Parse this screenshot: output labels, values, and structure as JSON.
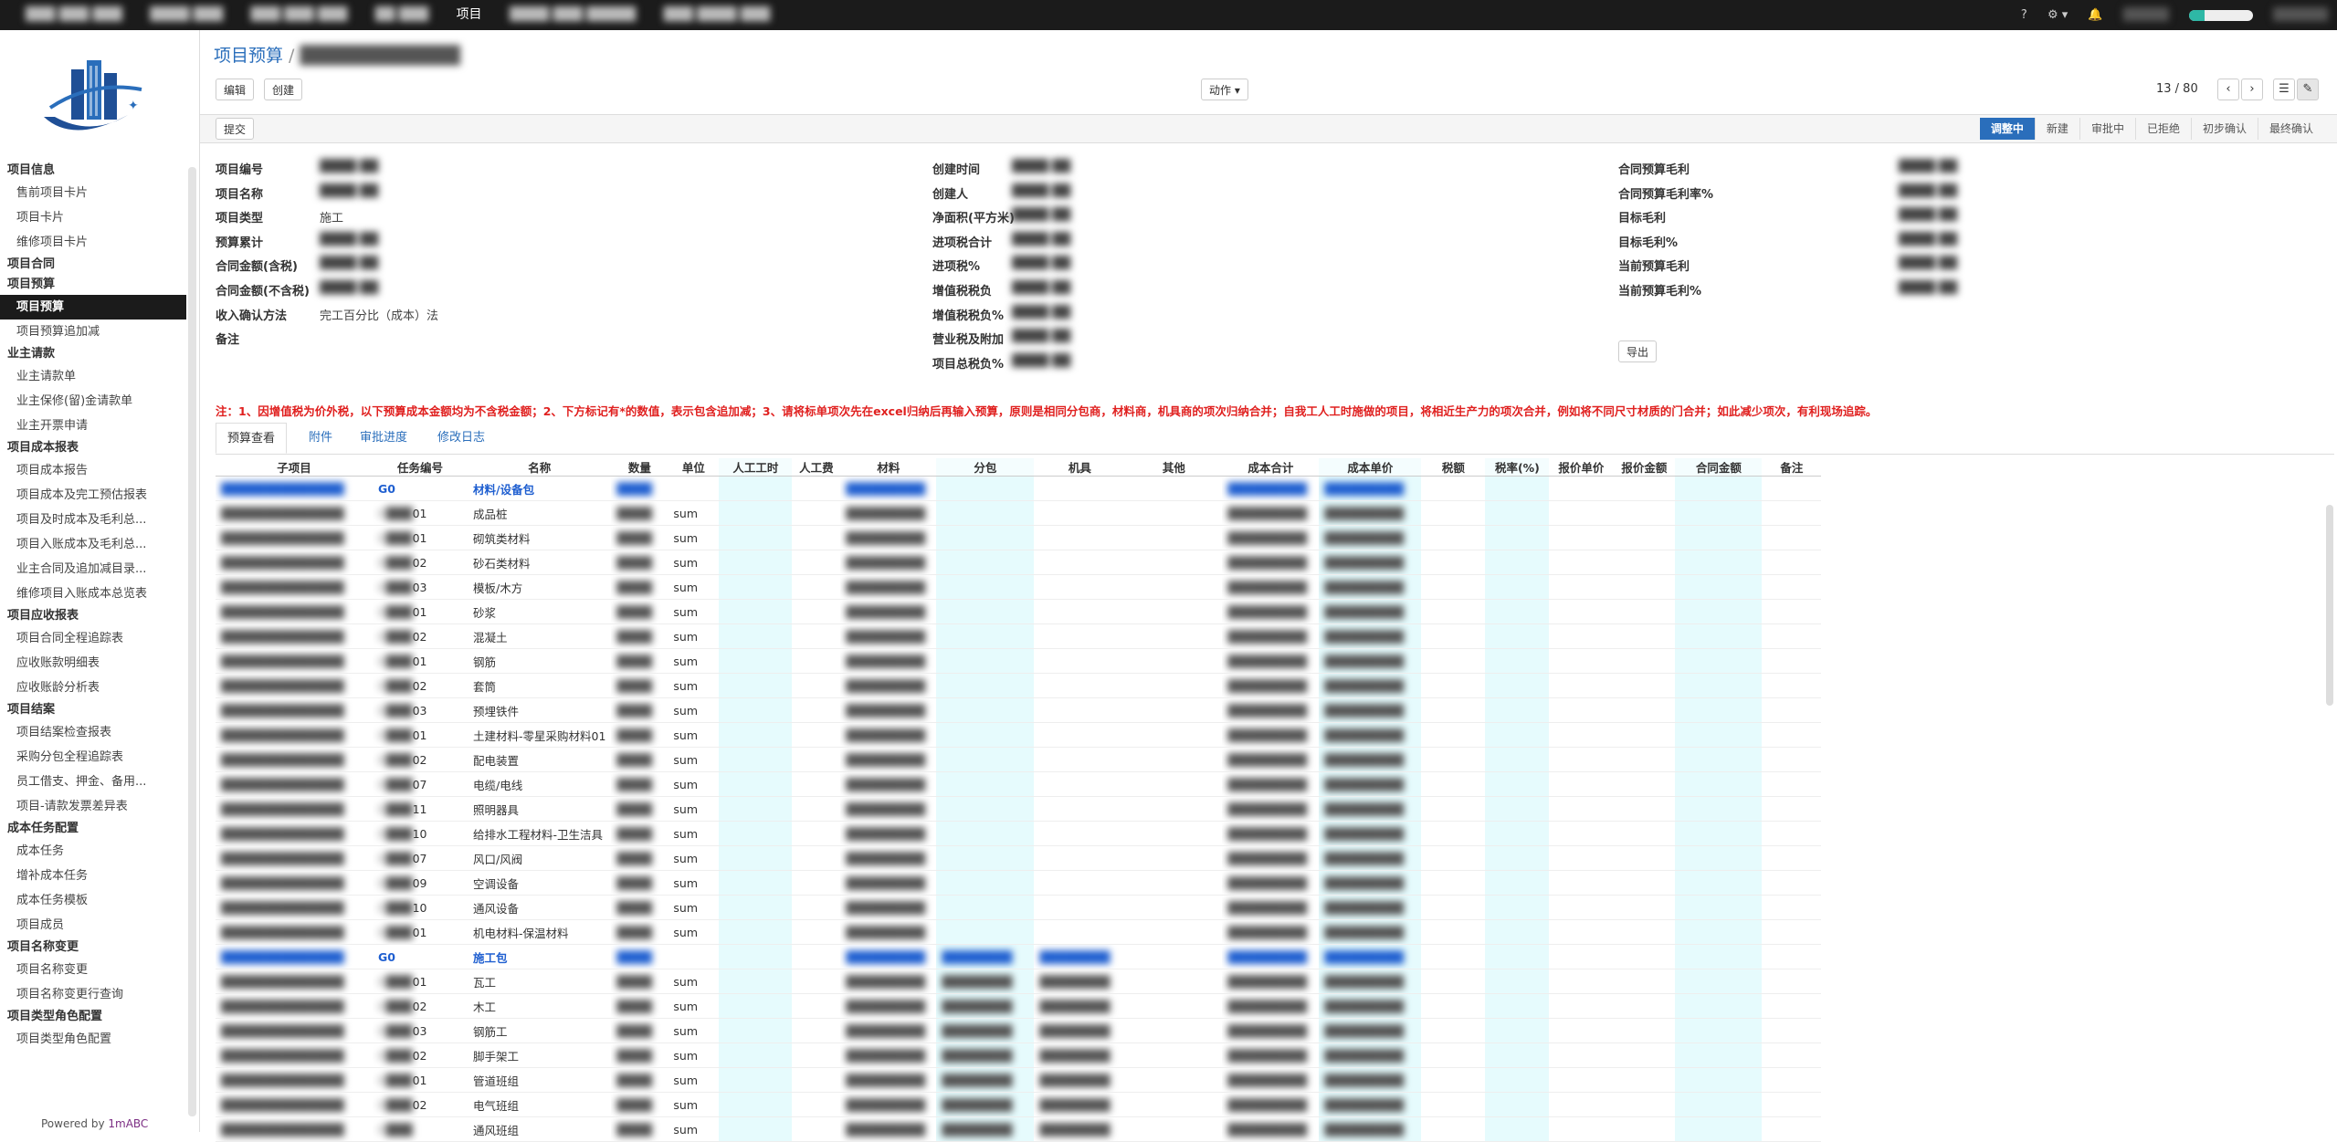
{
  "topbar": {
    "menu": [
      "项目"
    ],
    "right": [
      "?",
      "⚙ ▾",
      "🔔"
    ],
    "progress": 0.25
  },
  "sidebar": {
    "powered_prefix": "Powered by ",
    "powered_brand": "1mABC",
    "groups": [
      {
        "title": "项目信息",
        "items": [
          "售前项目卡片",
          "项目卡片",
          "维修项目卡片"
        ]
      },
      {
        "title": "项目合同",
        "items": []
      },
      {
        "title": "项目预算",
        "items": [
          "项目预算",
          "项目预算追加减"
        ]
      },
      {
        "title": "业主请款",
        "items": [
          "业主请款单",
          "业主保修(留)金请款单",
          "业主开票申请"
        ]
      },
      {
        "title": "项目成本报表",
        "items": [
          "项目成本报告",
          "项目成本及完工预估报表",
          "项目及时成本及毛利总...",
          "项目入账成本及毛利总...",
          "业主合同及追加减目录...",
          "维修项目入账成本总览表"
        ]
      },
      {
        "title": "项目应收报表",
        "items": [
          "项目合同全程追踪表",
          "应收账款明细表",
          "应收账龄分析表"
        ]
      },
      {
        "title": "项目结案",
        "items": [
          "项目结案检查报表",
          "采购分包全程追踪表",
          "员工借支、押金、备用...",
          "项目-请款发票差异表"
        ]
      },
      {
        "title": "成本任务配置",
        "items": [
          "成本任务",
          "增补成本任务",
          "成本任务模板",
          "项目成员"
        ]
      },
      {
        "title": "项目名称变更",
        "items": [
          "项目名称变更",
          "项目名称变更行查询"
        ]
      },
      {
        "title": "项目类型角色配置",
        "items": [
          "项目类型角色配置"
        ]
      }
    ],
    "active_item": "项目预算"
  },
  "header": {
    "breadcrumb_root": "项目预算",
    "breadcrumb_sep": "/",
    "edit_label": "编辑",
    "create_label": "创建",
    "action_label": "动作 ▾",
    "pager": "13 / 80",
    "prev": "‹",
    "next": "›",
    "list_view": "☰",
    "form_view": "✎"
  },
  "status": {
    "submit_label": "提交",
    "stages": [
      "调整中",
      "新建",
      "审批中",
      "已拒绝",
      "初步确认",
      "最终确认"
    ],
    "current": "调整中"
  },
  "form": {
    "col1": [
      {
        "label": "项目编号",
        "value": ""
      },
      {
        "label": "项目名称",
        "value": ""
      },
      {
        "label": "项目类型",
        "value": "施工"
      },
      {
        "label": "预算累计",
        "value": ""
      },
      {
        "label": "合同金额(含税)",
        "value": ""
      },
      {
        "label": "合同金额(不含税)",
        "value": ""
      },
      {
        "label": "收入确认方法",
        "value": "完工百分比（成本）法"
      },
      {
        "label": "备注",
        "value": ""
      }
    ],
    "col2": [
      {
        "label": "创建时间"
      },
      {
        "label": "创建人"
      },
      {
        "label": "净面积(平方米)"
      },
      {
        "label": "进项税合计"
      },
      {
        "label": "进项税%"
      },
      {
        "label": "增值税税负"
      },
      {
        "label": "增值税税负%"
      },
      {
        "label": "营业税及附加"
      },
      {
        "label": "项目总税负%"
      }
    ],
    "col3": [
      {
        "label": "合同预算毛利"
      },
      {
        "label": "合同预算毛利率%"
      },
      {
        "label": "目标毛利"
      },
      {
        "label": "目标毛利%"
      },
      {
        "label": "当前预算毛利"
      },
      {
        "label": "当前预算毛利%"
      }
    ],
    "export_label": "导出"
  },
  "note": "注：1、因增值税为价外税，以下预算成本金额均为不含税金额；2、下方标记有*的数值，表示包含追加减；3、请将标单项次先在excel归纳后再输入预算，原则是相同分包商，材料商，机具商的项次归纳合并；自我工人工时施做的项目，将相近生产力的项次合并，例如将不同尺寸材质的门合并；如此减少项次，有利现场追踪。",
  "tabs": [
    "预算查看",
    "附件",
    "审批进度",
    "修改日志"
  ],
  "table": {
    "columns": [
      "子项目",
      "任务编号",
      "名称",
      "数量",
      "单位",
      "人工工时",
      "人工费",
      "材料",
      "分包",
      "机具",
      "其他",
      "成本合计",
      "成本单价",
      "税额",
      "税率(%)",
      "报价单价",
      "报价金额",
      "合同金额",
      "备注"
    ],
    "rows": [
      {
        "group": true,
        "code": "G0",
        "name": "材料/设备包"
      },
      {
        "code": "01",
        "name": "成品桩",
        "unit": "sum"
      },
      {
        "code": "01",
        "name": "砌筑类材料",
        "unit": "sum"
      },
      {
        "code": "02",
        "name": "砂石类材料",
        "unit": "sum"
      },
      {
        "code": "03",
        "name": "模板/木方",
        "unit": "sum"
      },
      {
        "code": "01",
        "name": "砂浆",
        "unit": "sum"
      },
      {
        "code": "02",
        "name": "混凝土",
        "unit": "sum"
      },
      {
        "code": "01",
        "name": "钢筋",
        "unit": "sum"
      },
      {
        "code": "02",
        "name": "套筒",
        "unit": "sum"
      },
      {
        "code": "03",
        "name": "预埋铁件",
        "unit": "sum"
      },
      {
        "code": "01",
        "name": "土建材料-零星采购材料01",
        "unit": "sum"
      },
      {
        "code": "02",
        "name": "配电装置",
        "unit": "sum"
      },
      {
        "code": "07",
        "name": "电缆/电线",
        "unit": "sum"
      },
      {
        "code": "11",
        "name": "照明器具",
        "unit": "sum"
      },
      {
        "code": "10",
        "name": "给排水工程材料-卫生洁具",
        "unit": "sum"
      },
      {
        "code": "07",
        "name": "风口/风阀",
        "unit": "sum"
      },
      {
        "code": "09",
        "name": "空调设备",
        "unit": "sum"
      },
      {
        "code": "10",
        "name": "通风设备",
        "unit": "sum"
      },
      {
        "code": "01",
        "name": "机电材料-保温材料",
        "unit": "sum"
      },
      {
        "group": true,
        "code": "G0",
        "name": "施工包"
      },
      {
        "code": "01",
        "name": "瓦工",
        "unit": "sum"
      },
      {
        "code": "02",
        "name": "木工",
        "unit": "sum"
      },
      {
        "code": "03",
        "name": "钢筋工",
        "unit": "sum"
      },
      {
        "code": "02",
        "name": "脚手架工",
        "unit": "sum"
      },
      {
        "code": "01",
        "name": "管道班组",
        "unit": "sum"
      },
      {
        "code": "02",
        "name": "电气班组",
        "unit": "sum"
      },
      {
        "code": "",
        "name": "通风班组",
        "unit": "sum"
      }
    ]
  }
}
